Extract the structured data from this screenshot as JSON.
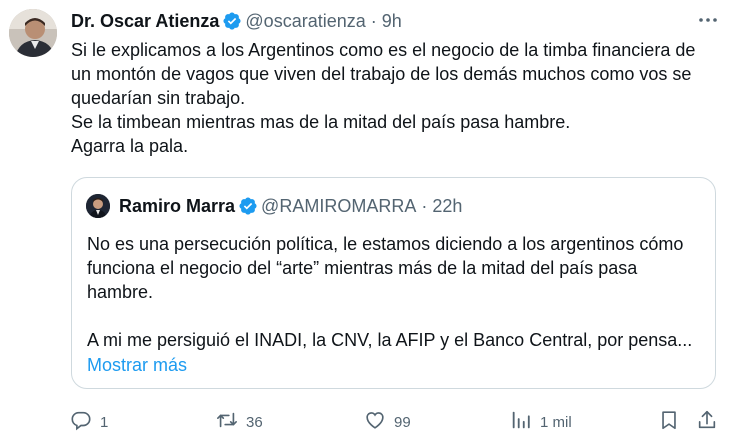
{
  "tweet": {
    "author_name": "Dr. Oscar Atienza",
    "handle": "@oscaratienza",
    "separator": "·",
    "time": "9h",
    "lines": [
      "Si le explicamos a los Argentinos como es el negocio de la timba financiera de",
      "un montón de vagos que viven del trabajo de los demás muchos como vos se",
      "quedarían sin trabajo.",
      "Se la timbean mientras mas de la mitad del país pasa hambre.",
      "Agarra la pala."
    ]
  },
  "quote": {
    "author_name": "Ramiro Marra",
    "handle": "@RAMIROMARRA",
    "separator": "·",
    "time": "22h",
    "lines": [
      "No es una persecución política, le estamos diciendo a los argentinos cómo",
      "funciona  el negocio del “arte” mientras más de la mitad del país pasa",
      "hambre.",
      "",
      "A mi me persiguió el INADI, la CNV, la AFIP y el Banco Central, por pensa..."
    ],
    "show_more": "Mostrar más"
  },
  "actions": {
    "replies": "1",
    "retweets": "36",
    "likes": "99",
    "views": "1 mil"
  },
  "icons": {
    "verified": "verified-badge-icon",
    "more": "more-options-icon",
    "reply": "reply-icon",
    "retweet": "retweet-icon",
    "like": "heart-icon",
    "views": "views-icon",
    "bookmark": "bookmark-icon",
    "share": "share-icon"
  },
  "colors": {
    "verified": "#1d9bf0",
    "link": "#1d9bf0",
    "secondary_text": "#536471",
    "border": "#cfd9de"
  }
}
